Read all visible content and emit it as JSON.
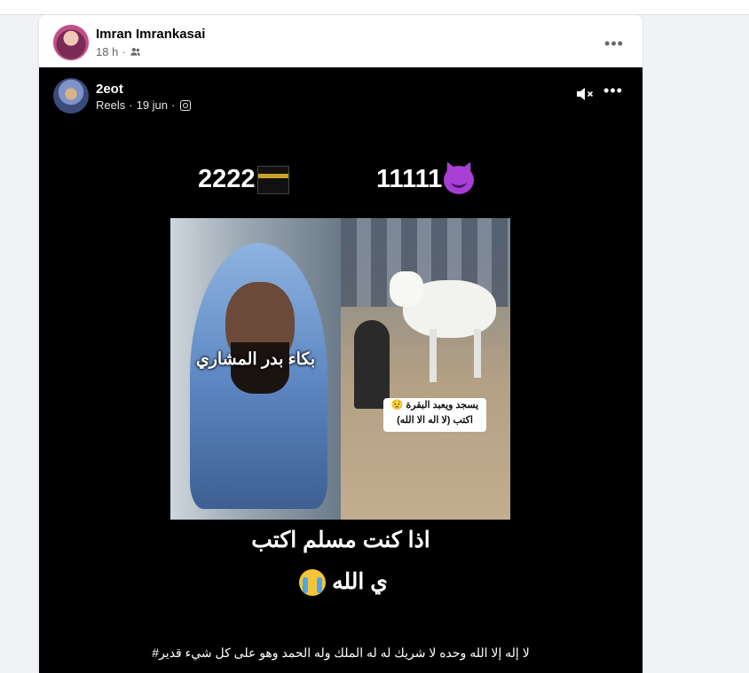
{
  "post": {
    "author": "Imran Imrankasai",
    "time": "18 h",
    "audience_icon": "friends-icon",
    "more_icon": "more-icon"
  },
  "shared": {
    "author": "2eot",
    "source": "Reels",
    "date": "19 jun",
    "platform_icon": "instagram-icon",
    "mute_icon": "muted-speaker-icon"
  },
  "video": {
    "vote_left": "2222",
    "vote_left_icon": "kaaba-icon",
    "vote_right": "11111",
    "vote_right_icon": "devil-emoji-icon",
    "left_photo_caption": "بكاء بدر المشاري",
    "sticker_line1": "يسجد ويعبد البقرة 😟",
    "sticker_line2": "اكتب (لا اله الا الله)",
    "caption_line1": "اذا كنت مسلم اكتب",
    "caption_line2": "ي الله",
    "caption_icon": "crying-face-icon",
    "bottom_text": "لا إله إلا الله وحده لا شريك له له الملك وله الحمد وهو على كل شيء قدير#"
  },
  "colors": {
    "page_bg": "#f0f2f5",
    "card_bg": "#ffffff",
    "video_bg": "#000000",
    "meta_text": "#65676b"
  }
}
